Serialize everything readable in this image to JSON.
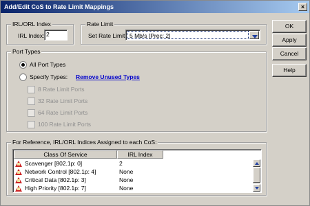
{
  "window": {
    "title": "Add/Edit CoS to Rate Limit Mappings",
    "close_glyph": "×"
  },
  "irl": {
    "group_label": "IRL/ORL Index",
    "index_label": "IRL Index:",
    "index_value": "2"
  },
  "rate_limit": {
    "group_label": "Rate Limit",
    "set_label": "Set Rate Limit:",
    "selected": "5 Mb/s [Prec: 2]"
  },
  "port_types": {
    "group_label": "Port Types",
    "all_label": "All Port Types",
    "specify_label": "Specify Types:",
    "remove_link": "Remove Unused Types",
    "checkboxes": [
      "8 Rate Limit Ports",
      "32 Rate Limit Ports",
      "64 Rate Limit Ports",
      "100 Rate Limit Ports"
    ]
  },
  "reference": {
    "group_label": "For Reference, IRL/ORL Indices Assigned to each CoS:",
    "columns": [
      "Class Of Service",
      "IRL Index"
    ],
    "rows": [
      {
        "cos": "Scavenger [802.1p: 0]",
        "index": "2"
      },
      {
        "cos": "Network Control [802.1p: 4]",
        "index": "None"
      },
      {
        "cos": "Critical Data [802.1p: 3]",
        "index": "None"
      },
      {
        "cos": "High Priority [802.1p: 7]",
        "index": "None"
      }
    ]
  },
  "buttons": {
    "ok": "OK",
    "apply": "Apply",
    "cancel": "Cancel",
    "help": "Help"
  }
}
